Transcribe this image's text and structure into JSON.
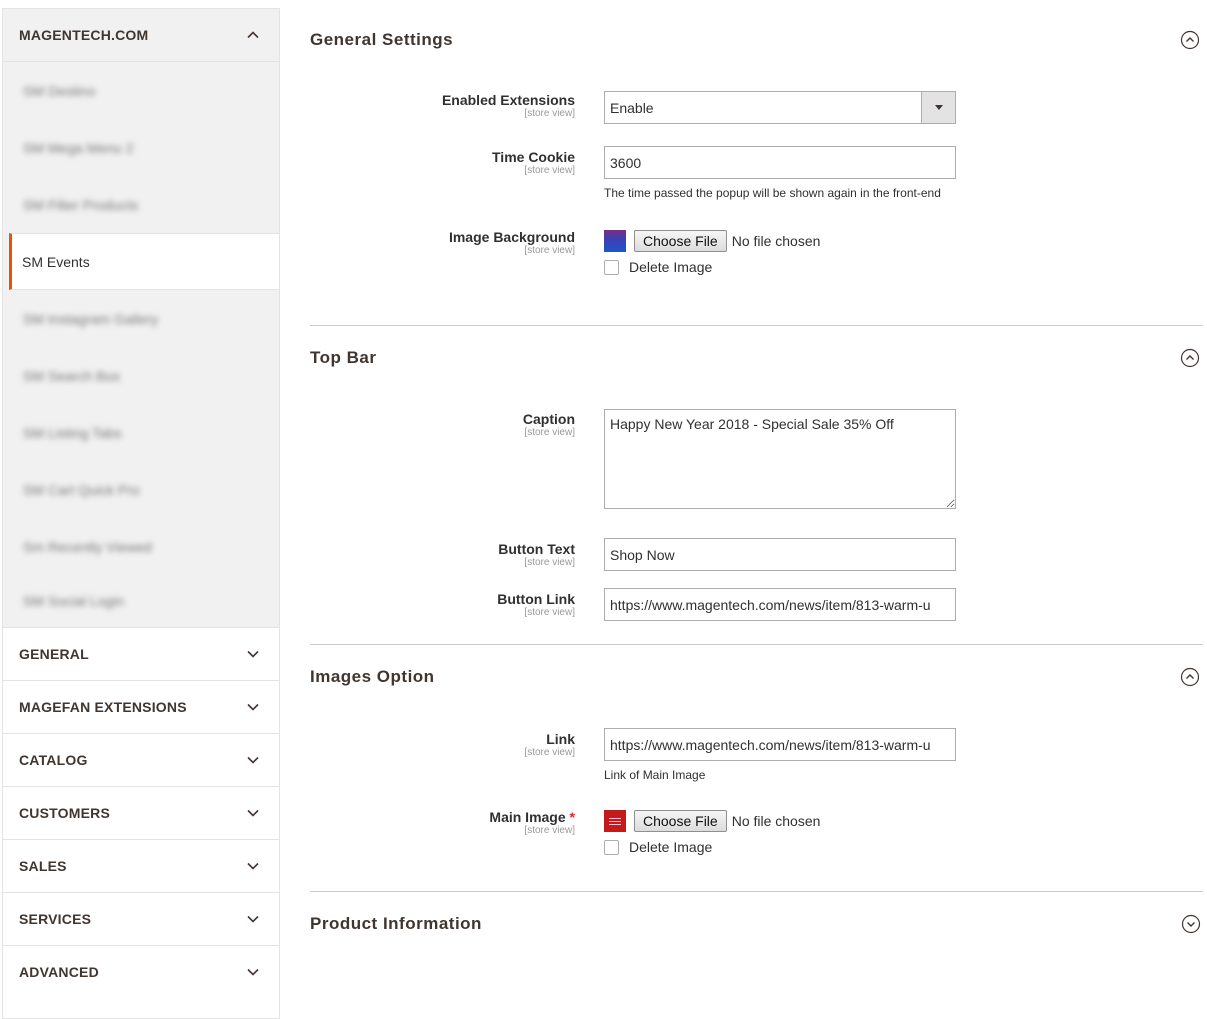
{
  "sidebar": {
    "header": "MAGENTECH.COM",
    "items": [
      {
        "label": "SM Destino",
        "blurred": true
      },
      {
        "label": "SM Mega Menu 2",
        "blurred": true
      },
      {
        "label": "SM Filter Products",
        "blurred": true
      },
      {
        "label": "SM Events",
        "blurred": false,
        "active": true
      },
      {
        "label": "SM Instagram Gallery",
        "blurred": true
      },
      {
        "label": "SM Search Box",
        "blurred": true
      },
      {
        "label": "SM Listing Tabs",
        "blurred": true
      },
      {
        "label": "SM Cart Quick Pro",
        "blurred": true
      },
      {
        "label": "Sm Recently Viewed",
        "blurred": true
      },
      {
        "label": "SM Social Login",
        "blurred": true
      }
    ],
    "groups": [
      "GENERAL",
      "MAGEFAN EXTENSIONS",
      "CATALOG",
      "CUSTOMERS",
      "SALES",
      "SERVICES",
      "ADVANCED"
    ]
  },
  "scope": "[store view]",
  "general": {
    "title": "General Settings",
    "enabled_label": "Enabled Extensions",
    "enabled_value": "Enable",
    "time_cookie_label": "Time Cookie",
    "time_cookie_value": "3600",
    "time_cookie_note": "The time passed the popup will be shown again in the front-end",
    "image_bg_label": "Image Background",
    "choose_file": "Choose File",
    "no_file": "No file chosen",
    "delete_image": "Delete Image"
  },
  "topbar": {
    "title": "Top Bar",
    "caption_label": "Caption",
    "caption_value": "Happy New Year 2018 - Special Sale 35% Off",
    "button_text_label": "Button Text",
    "button_text_value": "Shop Now",
    "button_link_label": "Button Link",
    "button_link_value": "https://www.magentech.com/news/item/813-warm-u"
  },
  "images": {
    "title": "Images Option",
    "link_label": "Link",
    "link_value": "https://www.magentech.com/news/item/813-warm-u",
    "link_note": "Link of Main Image",
    "main_image_label": "Main Image",
    "required_mark": "*",
    "choose_file": "Choose File",
    "no_file": "No file chosen",
    "delete_image": "Delete Image"
  },
  "product": {
    "title": "Product Information"
  },
  "colors": {
    "accent": "#eb5202",
    "sidebar_bg": "#f1f1f1",
    "border": "#adadad"
  }
}
